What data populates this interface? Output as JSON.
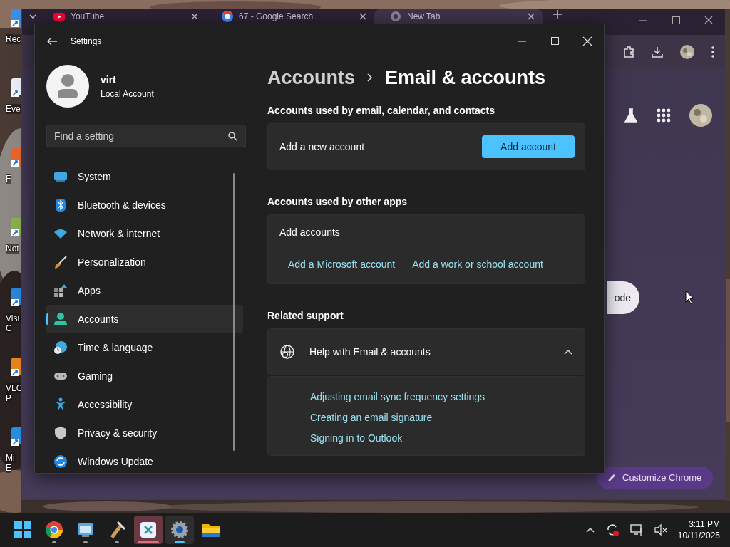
{
  "desktop": {
    "icons": [
      {
        "lines": [
          "Rec"
        ]
      },
      {
        "lines": [
          "Eve"
        ]
      },
      {
        "lines": [
          "F"
        ]
      },
      {
        "lines": [
          "Not"
        ]
      },
      {
        "lines": [
          "Visu",
          "C"
        ]
      },
      {
        "lines": [
          "VLC",
          "P"
        ]
      },
      {
        "lines": [
          "Mi",
          "E"
        ]
      }
    ]
  },
  "browser": {
    "tabs": [
      {
        "title": "YouTube",
        "selected": false
      },
      {
        "title": "67 - Google Search",
        "selected": false
      },
      {
        "title": "New Tab",
        "selected": true
      }
    ],
    "pill_button": "ode",
    "customize_button": "Customize Chrome"
  },
  "settings": {
    "title": "Settings",
    "user": {
      "name": "virt",
      "account_type": "Local Account"
    },
    "search": {
      "placeholder": "Find a setting"
    },
    "nav": [
      {
        "label": "System",
        "selected": false
      },
      {
        "label": "Bluetooth & devices",
        "selected": false
      },
      {
        "label": "Network & internet",
        "selected": false
      },
      {
        "label": "Personalization",
        "selected": false
      },
      {
        "label": "Apps",
        "selected": false
      },
      {
        "label": "Accounts",
        "selected": true
      },
      {
        "label": "Time & language",
        "selected": false
      },
      {
        "label": "Gaming",
        "selected": false
      },
      {
        "label": "Accessibility",
        "selected": false
      },
      {
        "label": "Privacy & security",
        "selected": false
      },
      {
        "label": "Windows Update",
        "selected": false
      }
    ],
    "breadcrumb": {
      "parent": "Accounts",
      "current": "Email & accounts"
    },
    "email_section": {
      "heading": "Accounts used by email, calendar, and contacts",
      "label": "Add a new account",
      "button": "Add account"
    },
    "apps_section": {
      "heading": "Accounts used by other apps",
      "label": "Add accounts",
      "links": [
        "Add a Microsoft account",
        "Add a work or school account"
      ]
    },
    "support": {
      "heading": "Related support",
      "title": "Help with Email & accounts",
      "expanded": true,
      "links": [
        "Adjusting email sync frequency settings",
        "Creating an email signature",
        "Signing in to Outlook"
      ]
    }
  },
  "taskbar": {
    "apps": [
      {
        "running": false,
        "selected": false,
        "attention": false
      },
      {
        "running": true,
        "selected": false,
        "attention": false
      },
      {
        "running": true,
        "selected": false,
        "attention": false
      },
      {
        "running": true,
        "selected": false,
        "attention": false
      },
      {
        "running": true,
        "selected": false,
        "attention": true
      },
      {
        "running": true,
        "selected": true,
        "attention": false
      },
      {
        "running": false,
        "selected": false,
        "attention": false
      }
    ],
    "clock": {
      "time": "3:11 PM",
      "date": "10/11/2025"
    }
  }
}
